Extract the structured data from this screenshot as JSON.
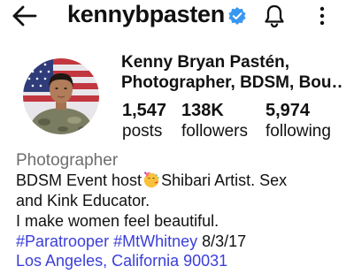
{
  "header": {
    "username": "kennybpasten",
    "back_icon": "arrow-left-icon",
    "verified_icon": "verified-badge-icon",
    "bell_icon": "bell-icon",
    "more_icon": "more-vertical-icon"
  },
  "profile": {
    "name_line1": "Kenny Bryan Pastén,",
    "name_line2": "Photographer, BDSM, Bou…",
    "stats": {
      "posts_count": "1,547",
      "posts_label": "posts",
      "followers_count": "138K",
      "followers_label": "followers",
      "following_count": "5,974",
      "following_label": "following"
    }
  },
  "bio": {
    "category": "Photographer",
    "line1_part1": "BDSM Event host",
    "line1_part2": "Shibari Artist. Sex",
    "line2": "and Kink Educator.",
    "line3": "I make women feel beautiful.",
    "hashtag1": "#Paratrooper",
    "hashtag2": "#MtWhitney",
    "date": "8/3/17",
    "location": "Los Angeles, California 90031",
    "emoji_icon": "party-face-emoji-icon"
  },
  "colors": {
    "link": "#3b3fd8",
    "verified": "#3897f0",
    "muted": "#6e6e6e",
    "text": "#111111"
  }
}
